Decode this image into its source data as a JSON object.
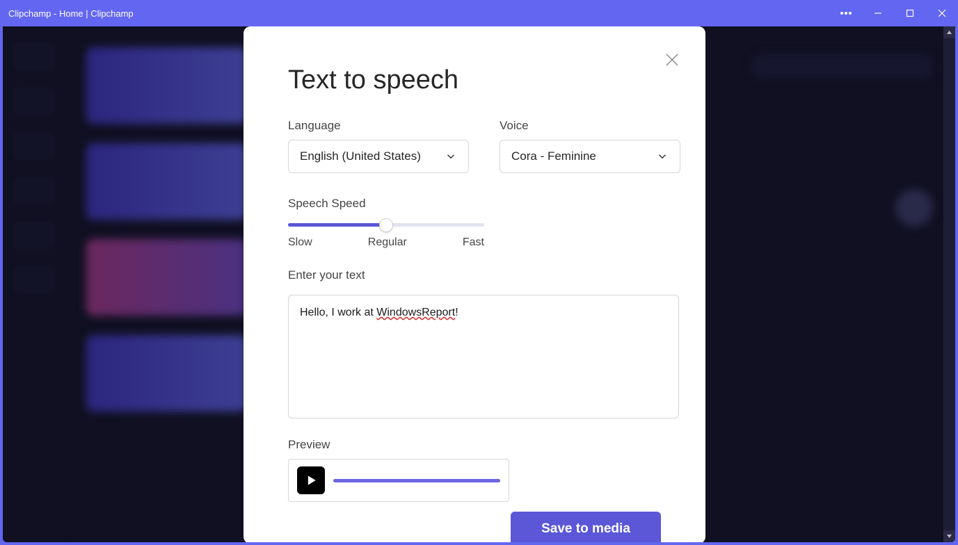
{
  "window": {
    "title": "Clipchamp - Home | Clipchamp"
  },
  "modal": {
    "title": "Text to speech",
    "language": {
      "label": "Language",
      "value": "English (United States)"
    },
    "voice": {
      "label": "Voice",
      "value": "Cora - Feminine"
    },
    "speed": {
      "label": "Speech Speed",
      "slow": "Slow",
      "regular": "Regular",
      "fast": "Fast",
      "value_percent": 50
    },
    "text": {
      "label": "Enter your text",
      "prefix": "Hello, I work at ",
      "highlight": "WindowsReport",
      "suffix": "!"
    },
    "preview": {
      "label": "Preview"
    },
    "save": "Save to media"
  }
}
